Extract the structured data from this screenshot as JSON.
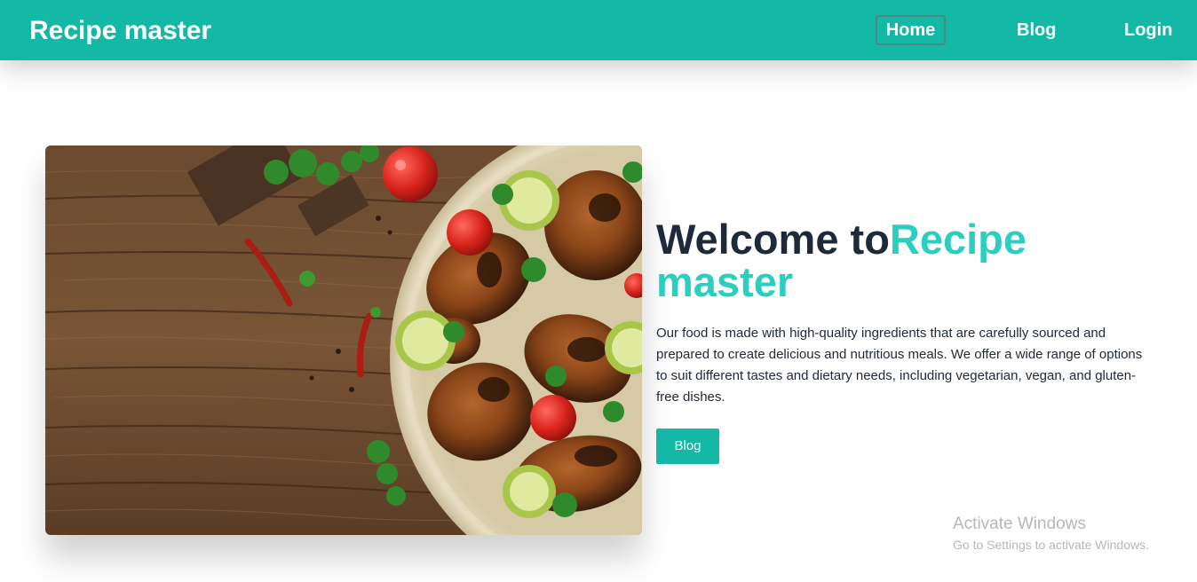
{
  "app": {
    "brand": "Recipe master"
  },
  "nav": {
    "items": [
      {
        "label": "Home",
        "active": true
      },
      {
        "label": "Blog",
        "active": false
      },
      {
        "label": "Login",
        "active": false
      }
    ]
  },
  "hero": {
    "title_prefix": "Welcome to",
    "title_accent": "Recipe master",
    "description": "Our food is made with high-quality ingredients that are carefully sourced and prepared to create delicious and nutritious meals. We offer a wide range of options to suit different tastes and dietary needs, including vegetarian, vegan, and gluten-free dishes.",
    "button_label": "Blog",
    "image_subject": "grilled-chicken-wings-platter"
  },
  "watermark": {
    "title": "Activate Windows",
    "subtitle": "Go to Settings to activate Windows."
  },
  "colors": {
    "primary": "#14b8a6",
    "accent_text": "#2ccfbf",
    "heading": "#1e2a3a",
    "body_text": "#1f2937",
    "watermark": "#b7b7b7"
  }
}
